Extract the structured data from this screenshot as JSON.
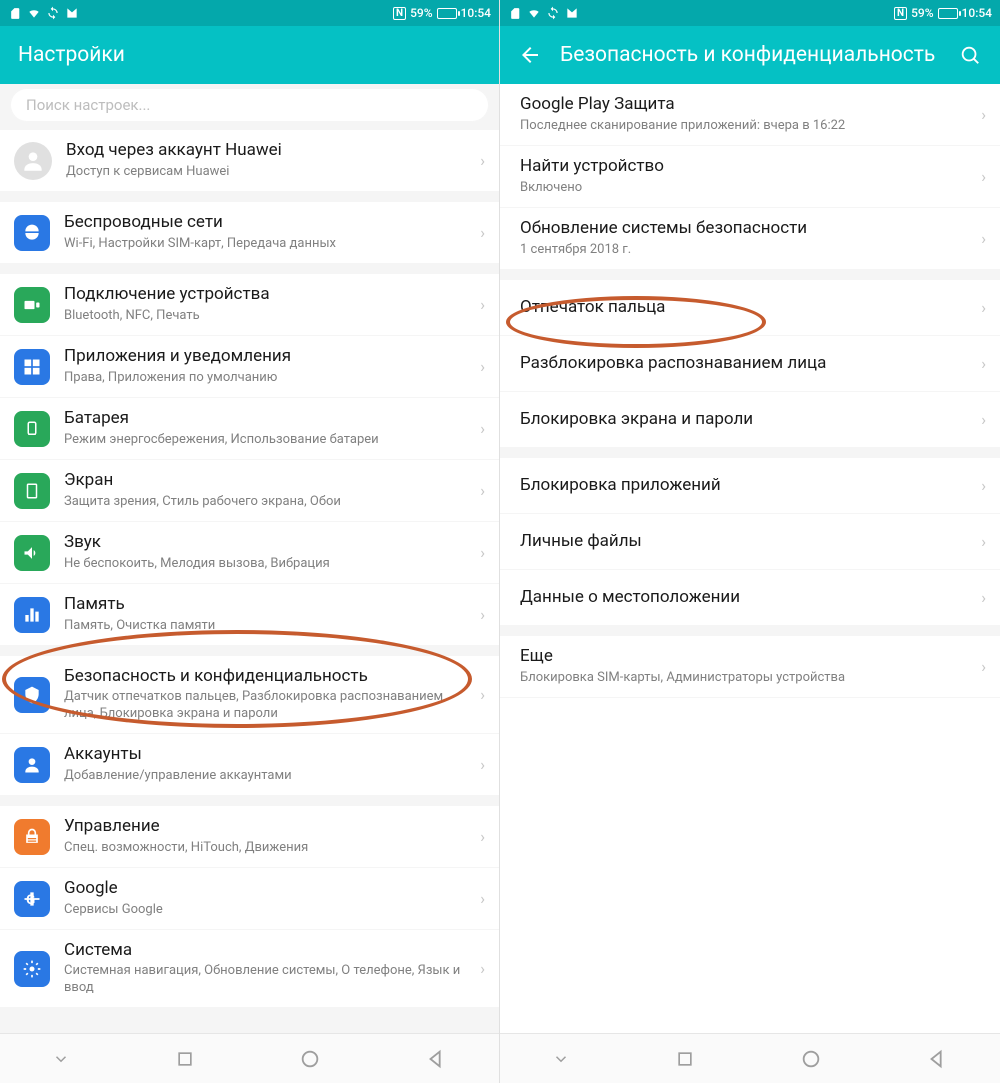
{
  "status": {
    "nfc": "N",
    "battery_pct": "59%",
    "time": "10:54"
  },
  "left": {
    "header_title": "Настройки",
    "search_placeholder": "Поиск настроек...",
    "account": {
      "title": "Вход через аккаунт Huawei",
      "sub": "Доступ к сервисам Huawei"
    },
    "items": [
      {
        "title": "Беспроводные сети",
        "sub": "Wi-Fi, Настройки SIM-карт, Передача данных",
        "color": "#2a78e4"
      },
      {
        "title": "Подключение устройства",
        "sub": "Bluetooth, NFC, Печать",
        "color": "#29a85a"
      },
      {
        "title": "Приложения и уведомления",
        "sub": "Права, Приложения по умолчанию",
        "color": "#2a78e4"
      },
      {
        "title": "Батарея",
        "sub": "Режим энергосбережения, Использование батареи",
        "color": "#29a85a"
      },
      {
        "title": "Экран",
        "sub": "Защита зрения, Стиль рабочего экрана, Обои",
        "color": "#29a85a"
      },
      {
        "title": "Звук",
        "sub": "Не беспокоить, Мелодия вызова, Вибрация",
        "color": "#29a85a"
      },
      {
        "title": "Память",
        "sub": "Память, Очистка памяти",
        "color": "#2a78e4"
      },
      {
        "title": "Безопасность и конфиденциальность",
        "sub": "Датчик отпечатков пальцев, Разблокировка распознаванием лица, Блокировка экрана и пароли",
        "color": "#2a78e4"
      },
      {
        "title": "Аккаунты",
        "sub": "Добавление/управление аккаунтами",
        "color": "#2a78e4"
      },
      {
        "title": "Управление",
        "sub": "Спец. возможности, HiTouch, Движения",
        "color": "#f07b2e"
      },
      {
        "title": "Google",
        "sub": "Сервисы Google",
        "color": "#2a78e4"
      },
      {
        "title": "Система",
        "sub": "Системная навигация, Обновление системы, О телефоне, Язык и ввод",
        "color": "#2a78e4"
      }
    ]
  },
  "right": {
    "header_title": "Безопасность и конфиденциальность",
    "groups": [
      [
        {
          "title": "Google Play Защита",
          "sub": "Последнее сканирование приложений: вчера в 16:22"
        },
        {
          "title": "Найти устройство",
          "sub": "Включено"
        },
        {
          "title": "Обновление системы безопасности",
          "sub": "1 сентября 2018 г."
        }
      ],
      [
        {
          "title": "Отпечаток пальца"
        },
        {
          "title": "Разблокировка распознаванием лица"
        },
        {
          "title": "Блокировка экрана и пароли"
        }
      ],
      [
        {
          "title": "Блокировка приложений"
        },
        {
          "title": "Личные файлы"
        },
        {
          "title": "Данные о местоположении"
        }
      ],
      [
        {
          "title": "Еще",
          "sub": "Блокировка SIM-карты, Администраторы устройства"
        }
      ]
    ]
  }
}
